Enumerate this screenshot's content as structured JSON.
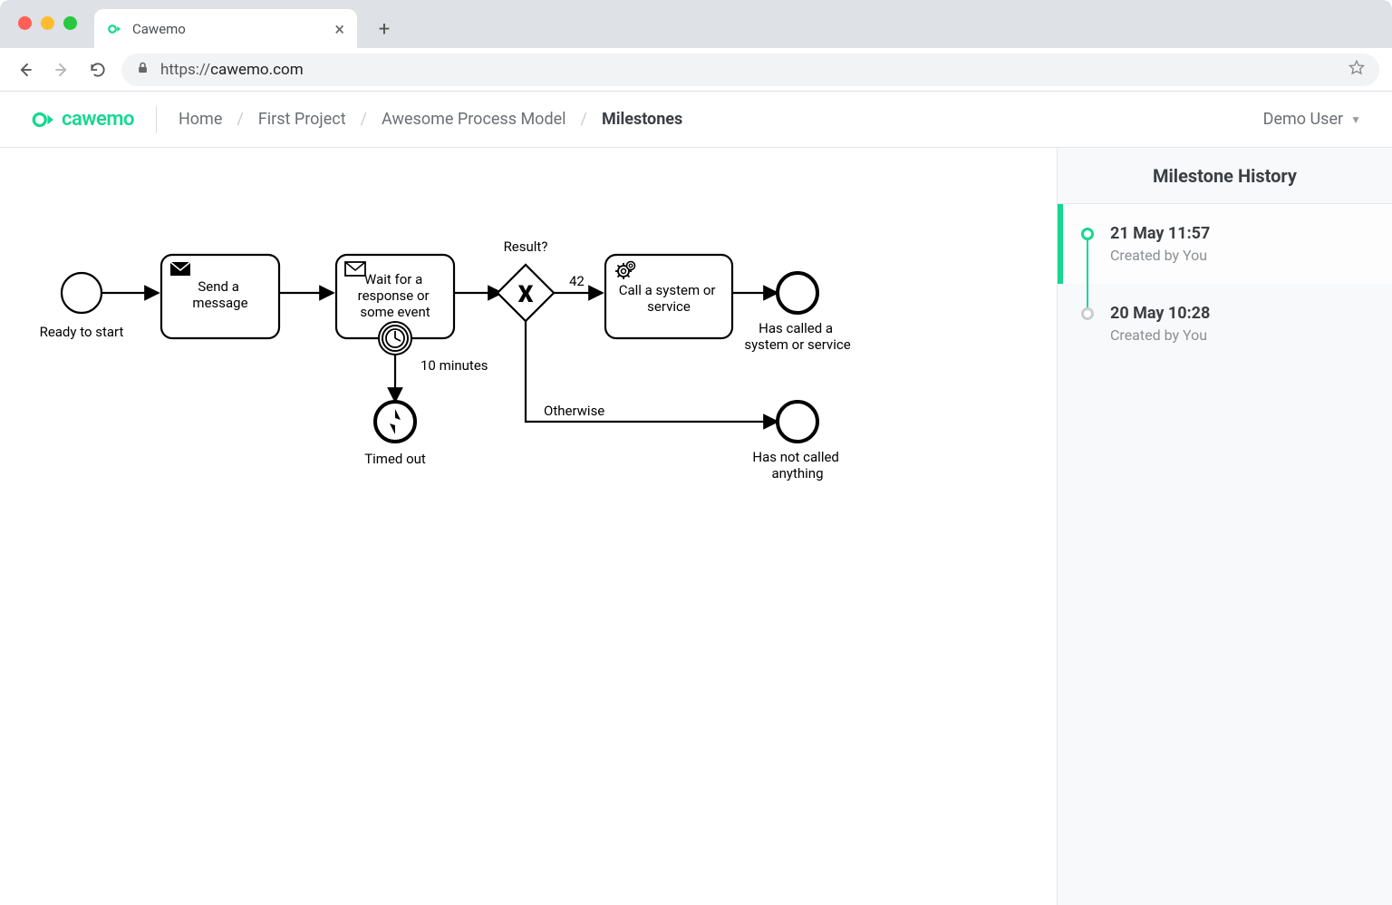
{
  "browser": {
    "tab_title": "Cawemo",
    "url_scheme": "https://",
    "url_domain": "cawemo.com"
  },
  "header": {
    "logo_text": "cawemo",
    "breadcrumbs": [
      "Home",
      "First Project",
      "Awesome Process Model",
      "Milestones"
    ],
    "user": "Demo User"
  },
  "side_panel": {
    "title": "Milestone History",
    "items": [
      {
        "title": "21 May 11:57",
        "subtitle": "Created by You",
        "active": true
      },
      {
        "title": "20 May 10:28",
        "subtitle": "Created by You",
        "active": false
      }
    ]
  },
  "diagram": {
    "start_label": "Ready to start",
    "task1": "Send a message",
    "task2_line1": "Wait for a",
    "task2_line2": "response or",
    "task2_line3": "some event",
    "gateway_label": "Result?",
    "flow_42": "42",
    "flow_otherwise": "Otherwise",
    "timer_label": "10 minutes",
    "timed_out": "Timed out",
    "task3_line1": "Call a system or",
    "task3_line2": "service",
    "end1_line1": "Has called a",
    "end1_line2": "system or service",
    "end2_line1": "Has not called",
    "end2_line2": "anything"
  }
}
